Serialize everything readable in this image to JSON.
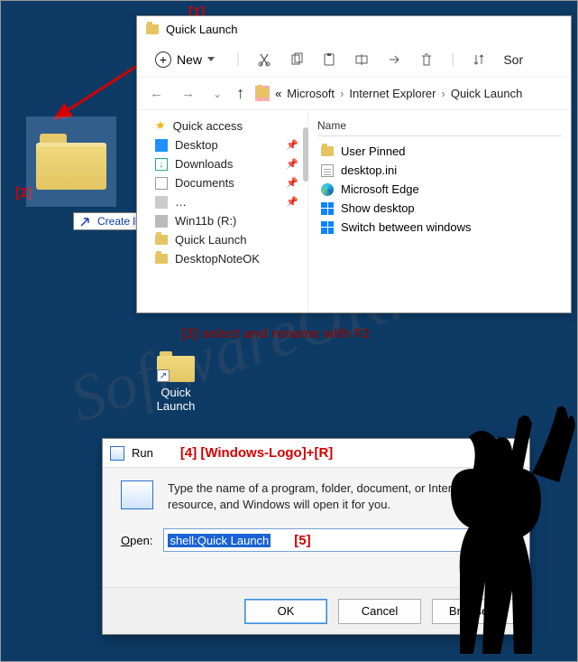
{
  "annotations": {
    "a1": "[1]",
    "a2": "[2]",
    "a3": "[3] select and rename with F2",
    "a4": "[4]  [Windows-Logo]+[R]",
    "a5": "[5]"
  },
  "tooltip": {
    "text": "Create link in Desktop"
  },
  "explorer": {
    "title": "Quick Launch",
    "new_label": "New",
    "sort_label": "Sor",
    "breadcrumb": {
      "pre": "«",
      "c1": "Microsoft",
      "c2": "Internet Explorer",
      "c3": "Quick Launch"
    },
    "nav": {
      "qa": "Quick access",
      "desktop": "Desktop",
      "downloads": "Downloads",
      "documents": "Documents",
      "win11b": "Win11b (R:)",
      "ql": "Quick Launch",
      "dnok": "DesktopNoteOK"
    },
    "main": {
      "header": "Name",
      "r0": "User Pinned",
      "r1": "desktop.ini",
      "r2": "Microsoft Edge",
      "r3": "Show desktop",
      "r4": "Switch between windows"
    }
  },
  "desktop_small": {
    "label": "Quick Launch"
  },
  "run": {
    "title": "Run",
    "msg": "Type the name of a program, folder, document, or Internet resource, and Windows will open it for you.",
    "open_label": "Open:",
    "value": "shell:Quick Launch",
    "ok": "OK",
    "cancel": "Cancel",
    "browse": "Browse..."
  },
  "watermark": "SoftwareOK.com"
}
